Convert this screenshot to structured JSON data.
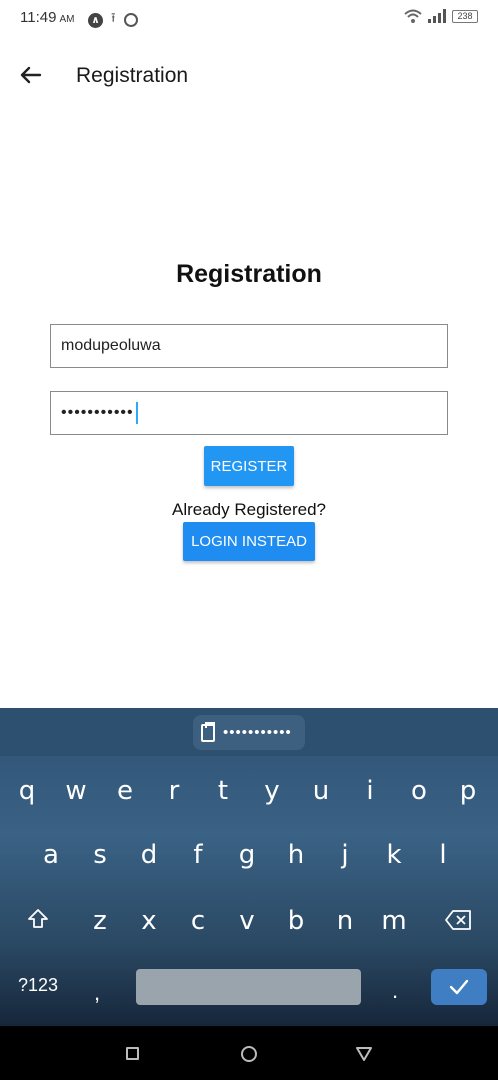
{
  "status_bar": {
    "time": "11:49",
    "ampm": "AM",
    "battery": "238"
  },
  "app_bar": {
    "title": "Registration"
  },
  "form": {
    "heading": "Registration",
    "username_value": "modupeoluwa",
    "password_masked": "•••••••••••",
    "register_label": "REGISTER",
    "already_text": "Already Registered?",
    "login_label": "LOGIN INSTEAD"
  },
  "keyboard": {
    "clipboard_preview": "•••••••••••",
    "row1": [
      "q",
      "w",
      "e",
      "r",
      "t",
      "y",
      "u",
      "i",
      "o",
      "p"
    ],
    "row2": [
      "a",
      "s",
      "d",
      "f",
      "g",
      "h",
      "j",
      "k",
      "l"
    ],
    "row3": [
      "z",
      "x",
      "c",
      "v",
      "b",
      "n",
      "m"
    ],
    "numbers_key": "?123",
    "comma_key": ",",
    "period_key": "."
  },
  "colors": {
    "primary_button": "#2196f3",
    "keyboard_bg": "#3a6285",
    "caret": "#2aa9ff"
  }
}
